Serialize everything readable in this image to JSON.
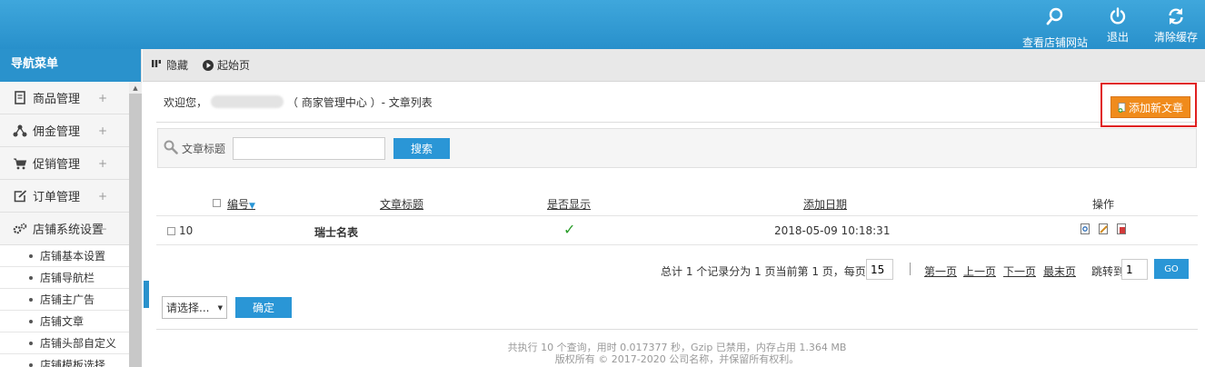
{
  "header": {
    "actions": [
      {
        "label": "查看店铺网站",
        "icon": "search-icon"
      },
      {
        "label": "退出",
        "icon": "power-icon"
      },
      {
        "label": "清除缓存",
        "icon": "refresh-icon"
      }
    ]
  },
  "sidebar": {
    "title": "导航菜单",
    "items": [
      {
        "label": "商品管理",
        "icon": "book-icon",
        "toggle": "+"
      },
      {
        "label": "佣金管理",
        "icon": "share-icon",
        "toggle": "+"
      },
      {
        "label": "促销管理",
        "icon": "cart-icon",
        "toggle": "+"
      },
      {
        "label": "订单管理",
        "icon": "edit-icon",
        "toggle": "+"
      },
      {
        "label": "店铺系统设置",
        "icon": "gears-icon",
        "toggle": "−"
      }
    ],
    "sub_items": [
      "店铺基本设置",
      "店铺导航栏",
      "店铺主广告",
      "店铺文章",
      "店铺头部自定义",
      "店铺模板选择"
    ]
  },
  "tabbar": {
    "hide_label": "隐藏",
    "home_label": "起始页"
  },
  "main": {
    "welcome_prefix": "欢迎您，",
    "welcome_suffix": "（ 商家管理中心 ）- 文章列表",
    "add_button": "添加新文章",
    "search": {
      "label": "文章标题",
      "value": "",
      "button": "搜索"
    },
    "table": {
      "headers": {
        "id": "编号",
        "title": "文章标题",
        "show": "是否显示",
        "date": "添加日期",
        "ops": "操作"
      },
      "rows": [
        {
          "id": "10",
          "title": "瑞士名表",
          "show": "✓",
          "date": "2018-05-09 10:18:31"
        }
      ]
    },
    "pager": {
      "summary": "总计 1 个记录分为 1 页当前第 1 页，每页",
      "page_size": "15",
      "first": "第一页",
      "prev": "上一页",
      "next": "下一页",
      "last": "最末页",
      "jump_label": "跳转到",
      "jump_value": "1",
      "go": "GO"
    },
    "batch": {
      "select": "请选择...",
      "confirm": "确定"
    },
    "footer": {
      "line1": "共执行 10 个查询，用时 0.017377 秒，Gzip 已禁用，内存占用 1.364 MB",
      "line2": "版权所有 © 2017-2020 公司名称，并保留所有权利。"
    }
  },
  "colors": {
    "header": "#2890cb",
    "accent": "#2a96d6",
    "add_button": "#f08b1c",
    "highlight": "#e02020",
    "check": "#2a9d2a"
  }
}
